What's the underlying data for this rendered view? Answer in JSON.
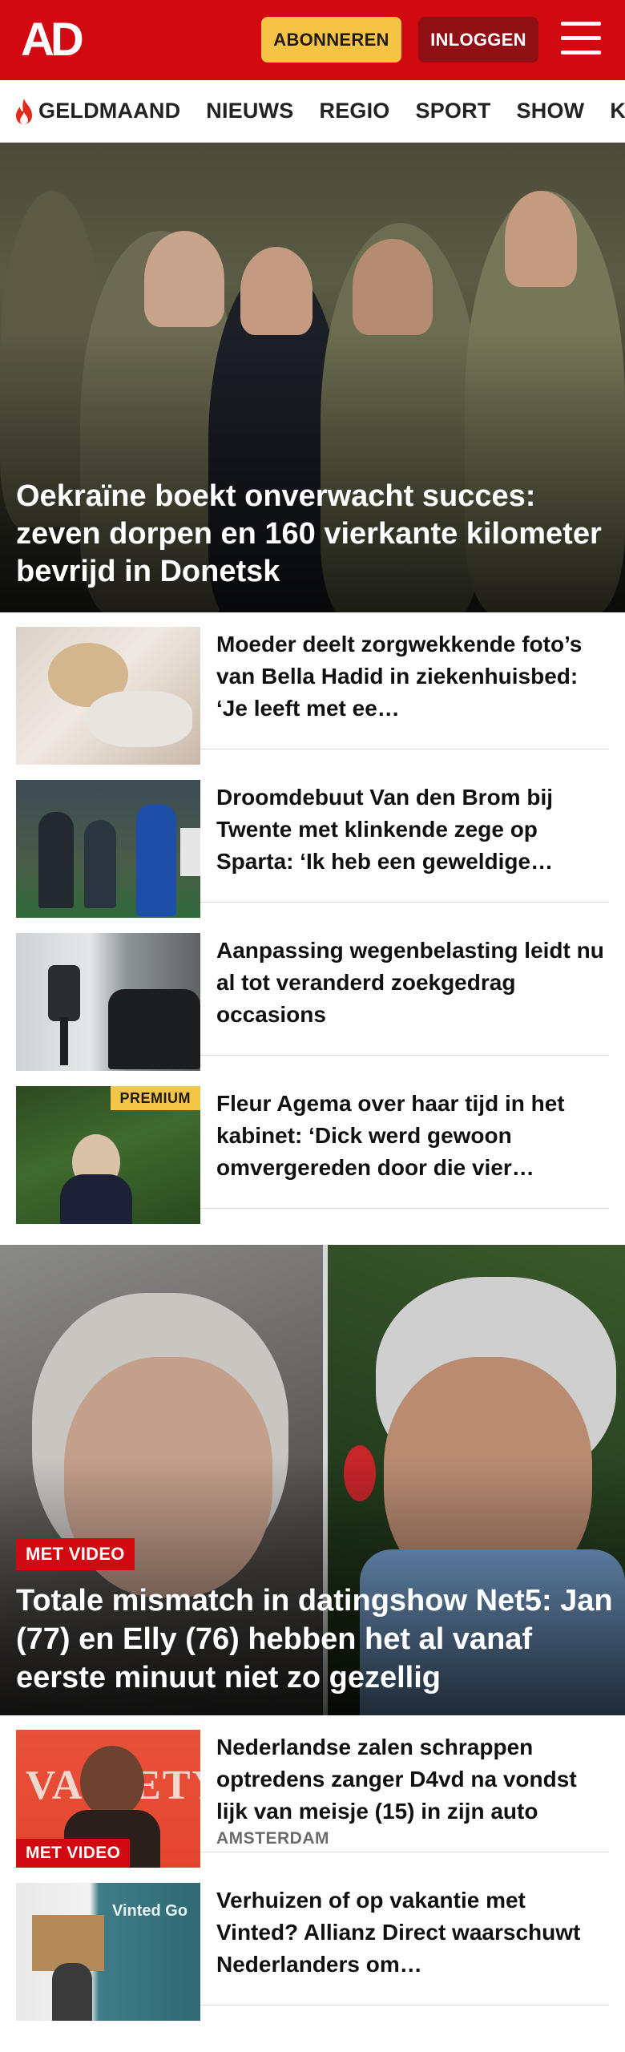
{
  "header": {
    "logo": "AD",
    "subscribe_label": "ABONNEREN",
    "login_label": "INLOGGEN",
    "menu_icon": "hamburger-icon",
    "brand_color": "#d10a11"
  },
  "nav": {
    "items": [
      {
        "label": "GELDMAAND",
        "icon": "flame-icon"
      },
      {
        "label": "NIEUWS"
      },
      {
        "label": "REGIO"
      },
      {
        "label": "SPORT"
      },
      {
        "label": "SHOW"
      },
      {
        "label": "KIJK"
      }
    ]
  },
  "hero": {
    "title": "Oekraïne boekt onverwacht succes: zeven dorpen en 160 vierkante kilometer bevrijd in Donetsk"
  },
  "articles": [
    {
      "title": "Moeder deelt zorgwekkende foto’s van Bella Hadid in ziekenhuisbed: ‘Je leeft met ee…"
    },
    {
      "title": "Droomdebuut Van den Brom bij Twente met klinkende zege op Sparta: ‘Ik heb een geweldige…"
    },
    {
      "title": "Aanpassing wegenbelasting leidt nu al tot veranderd zoekgedrag occasions"
    },
    {
      "title": "Fleur Agema over haar tijd in het kabinet: ‘Dick werd gewoon omvergereden door die vier…",
      "badge": "PREMIUM"
    }
  ],
  "video_hero": {
    "badge": "MET VIDEO",
    "title": "Totale mismatch in datingshow Net5: Jan (77) en Elly (76) hebben het al vanaf eerste minuut niet zo gezellig"
  },
  "articles_2": [
    {
      "title": "Nederlandse zalen schrappen optredens zanger D4vd na vondst lijk van meisje (15) in zijn auto",
      "badge": "MET VIDEO",
      "location": "AMSTERDAM"
    },
    {
      "title": "Verhuizen of op vakantie met Vinted? Allianz Direct waarschuwt Nederlanders om…"
    }
  ]
}
